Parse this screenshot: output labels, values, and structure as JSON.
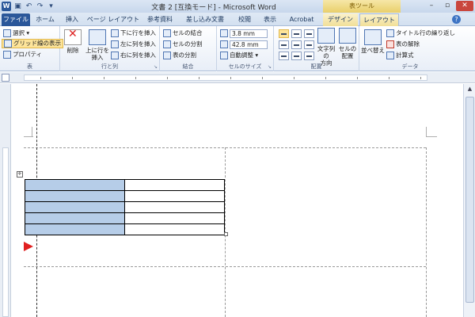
{
  "titlebar": {
    "title": "文書 2 [互換モード] - Microsoft Word",
    "context_label": "表ツール"
  },
  "tabs": [
    "ファイル",
    "ホーム",
    "挿入",
    "ページ レイアウト",
    "参考資料",
    "差し込み文書",
    "校閲",
    "表示",
    "Acrobat",
    "デザイン",
    "レイアウト"
  ],
  "ribbon": {
    "table_group": {
      "select": "選択 ▾",
      "gridlines": "グリッド線の表示",
      "properties": "プロパティ",
      "label": "表"
    },
    "rows_cols": {
      "delete": "削除",
      "insert_above_1": "上に行を",
      "insert_above_2": "挿入",
      "insert_below": "下に行を挿入",
      "insert_left": "左に列を挿入",
      "insert_right": "右に列を挿入",
      "label": "行と列"
    },
    "merge": {
      "merge_cells": "セルの結合",
      "split_cells": "セルの分割",
      "split_table": "表の分割",
      "label": "結合"
    },
    "cell_size": {
      "height": "3.8 mm",
      "width": "42.8 mm",
      "autofit": "自動調整 ▾",
      "label": "セルのサイズ"
    },
    "alignment": {
      "text_direction_1": "文字列の",
      "text_direction_2": "方向",
      "cell_margins_1": "セルの",
      "cell_margins_2": "配置",
      "label": "配置"
    },
    "data": {
      "sort": "並べ替え",
      "repeat_header": "タイトル行の繰り返し",
      "convert": "表の解除",
      "formula": "計算式",
      "label": "データ"
    }
  },
  "table": {
    "rows": 5,
    "cols": 2
  },
  "colors": {
    "accent": "#2b579a",
    "selected_cell": "#b6cde8",
    "arrow": "#e02020",
    "context_tab": "#f1df98"
  }
}
